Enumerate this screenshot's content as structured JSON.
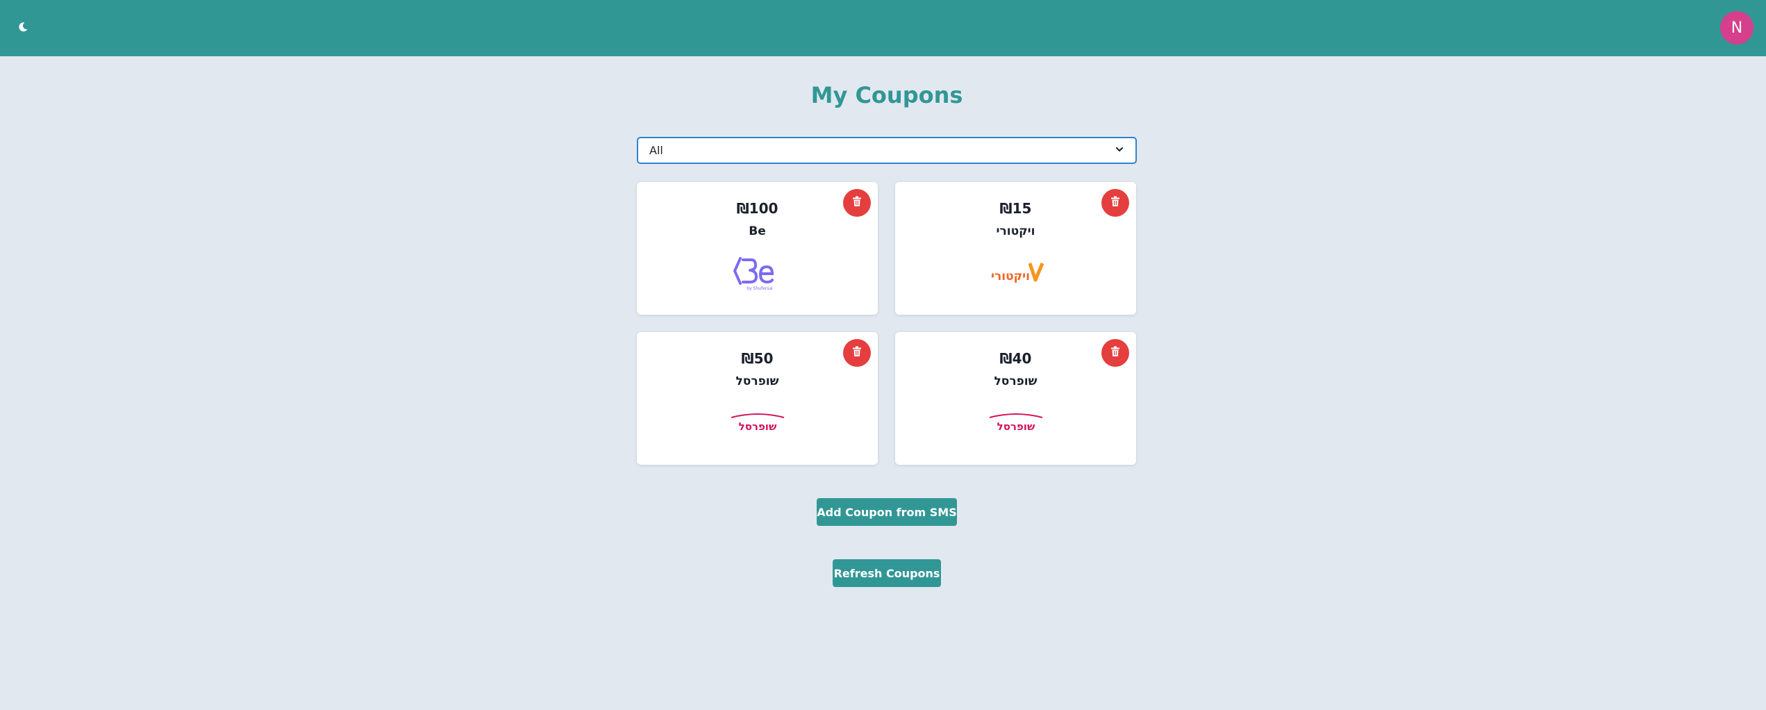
{
  "header": {
    "theme_icon": "moon-icon",
    "avatar_initial": "N",
    "colors": {
      "bar": "#319795",
      "avatar": "#d53f8c"
    }
  },
  "main": {
    "title": "My Coupons",
    "filter": {
      "selected": "All",
      "icon": "chevron-down-icon"
    },
    "coupons": [
      {
        "amount": "₪100",
        "store": "Be",
        "logo_text": "by Shufersal",
        "logo": "be-logo"
      },
      {
        "amount": "₪15",
        "store": "ויקטורי",
        "logo_text": "ויקטורי",
        "logo": "victory-logo"
      },
      {
        "amount": "₪50",
        "store": "שופרסל",
        "logo_text": "שופרסל",
        "logo": "shufersal-logo"
      },
      {
        "amount": "₪40",
        "store": "שופרסל",
        "logo_text": "שופרסל",
        "logo": "shufersal-logo"
      }
    ],
    "add_sms_label": "Add Coupon from SMS",
    "refresh_label": "Refresh Coupons",
    "colors": {
      "accent": "#319795",
      "delete": "#e53e3e",
      "select_border": "#3182ce"
    }
  }
}
